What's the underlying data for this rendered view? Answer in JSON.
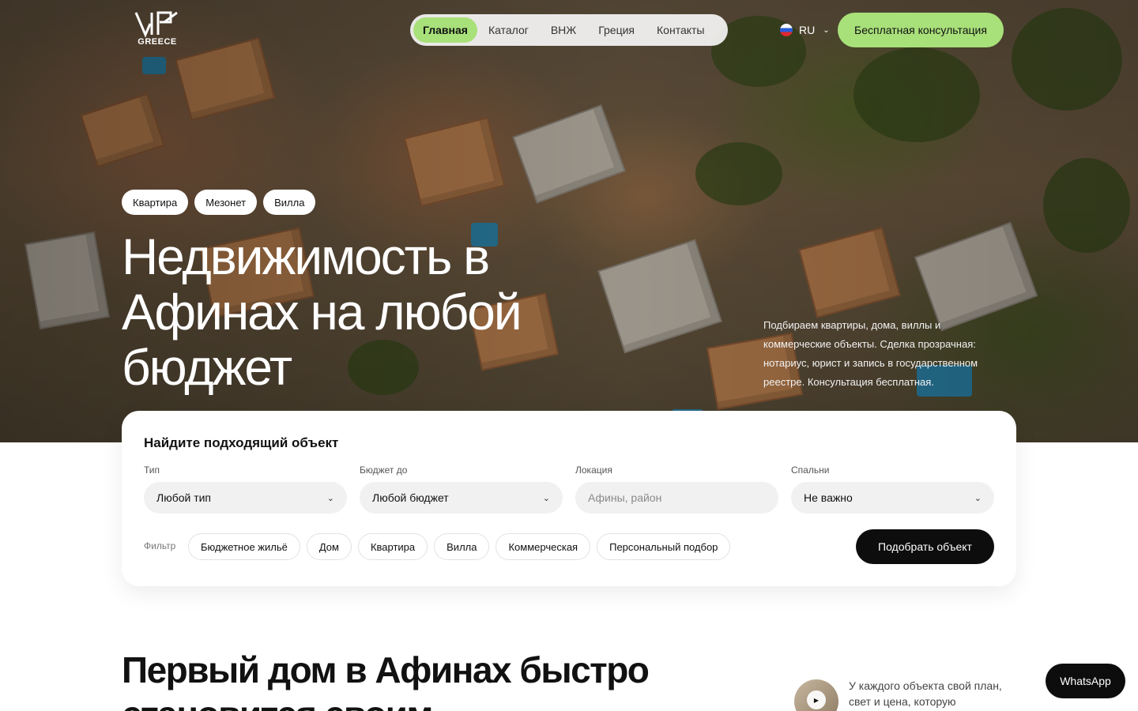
{
  "colors": {
    "accent": "#a8e07a",
    "dark": "#0d0d0d",
    "field_bg": "#f1f1f1"
  },
  "logo": {
    "text": "GREECE",
    "mark": "VIP"
  },
  "nav": {
    "items": [
      {
        "label": "Главная",
        "active": true
      },
      {
        "label": "Каталог",
        "active": false
      },
      {
        "label": "ВНЖ",
        "active": false
      },
      {
        "label": "Греция",
        "active": false
      },
      {
        "label": "Контакты",
        "active": false
      }
    ]
  },
  "language": {
    "code": "RU",
    "icon": "russia-flag-icon"
  },
  "header_cta": "Бесплатная консультация",
  "hero": {
    "chips": [
      "Квартира",
      "Мезонет",
      "Вилла"
    ],
    "title": "Недвижимость в Афинах на любой бюджет",
    "description": "Подбираем квартиры, дома, виллы и коммерческие объекты. Сделка прозрачная: нотариус, юрист и запись в государственном реестре. Консультация бесплатная."
  },
  "search": {
    "title": "Найдите подходящий объект",
    "fields": {
      "type": {
        "label": "Тип",
        "value": "Любой тип"
      },
      "budget": {
        "label": "Бюджет до",
        "value": "Любой бюджет"
      },
      "location": {
        "label": "Локация",
        "placeholder": "Афины, район"
      },
      "bedrooms": {
        "label": "Спальни",
        "value": "Не важно"
      }
    },
    "filter_label": "Фильтр",
    "filters": [
      "Бюджетное жильё",
      "Дом",
      "Квартира",
      "Вилла",
      "Коммерческая",
      "Персональный подбор"
    ],
    "submit": "Подобрать объект"
  },
  "section": {
    "title": "Первый дом в Афинах быстро становится своим",
    "video_caption": "У каждого объекта свой план, свет и цена, которую"
  },
  "whatsapp": "WhatsApp"
}
